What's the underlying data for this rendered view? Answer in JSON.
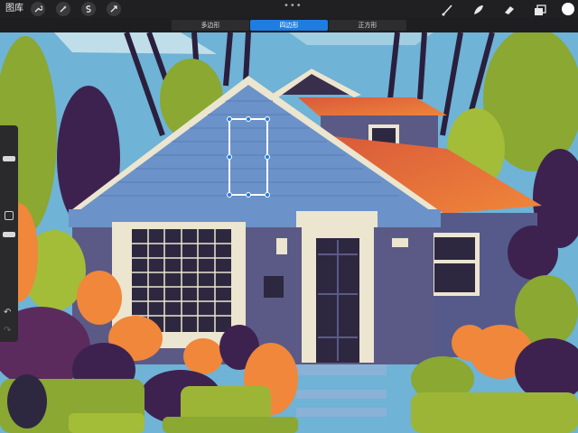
{
  "app": {
    "gallery_label": "图库"
  },
  "toolbar": {
    "left_tools": [
      "wrench-icon",
      "magic-wand-icon",
      "selection-icon",
      "transform-icon"
    ],
    "right_tools": [
      "brush-icon",
      "smudge-icon",
      "eraser-icon",
      "layers-icon"
    ],
    "more": "•••",
    "current_color": "#ffffff"
  },
  "shape_mode": {
    "options": [
      "多边形",
      "四边形",
      "正方形"
    ],
    "selected": "四边形",
    "accent": "#1e7de0"
  },
  "sidebar": {
    "undo_icon": "↶",
    "redo_icon": "↷"
  },
  "artwork": {
    "subject": "illustrated blue house with orange roof and trees",
    "sky_color": "#6fb3d6",
    "house_color": "#6b93c9",
    "roof_color": "#f06a3a"
  }
}
